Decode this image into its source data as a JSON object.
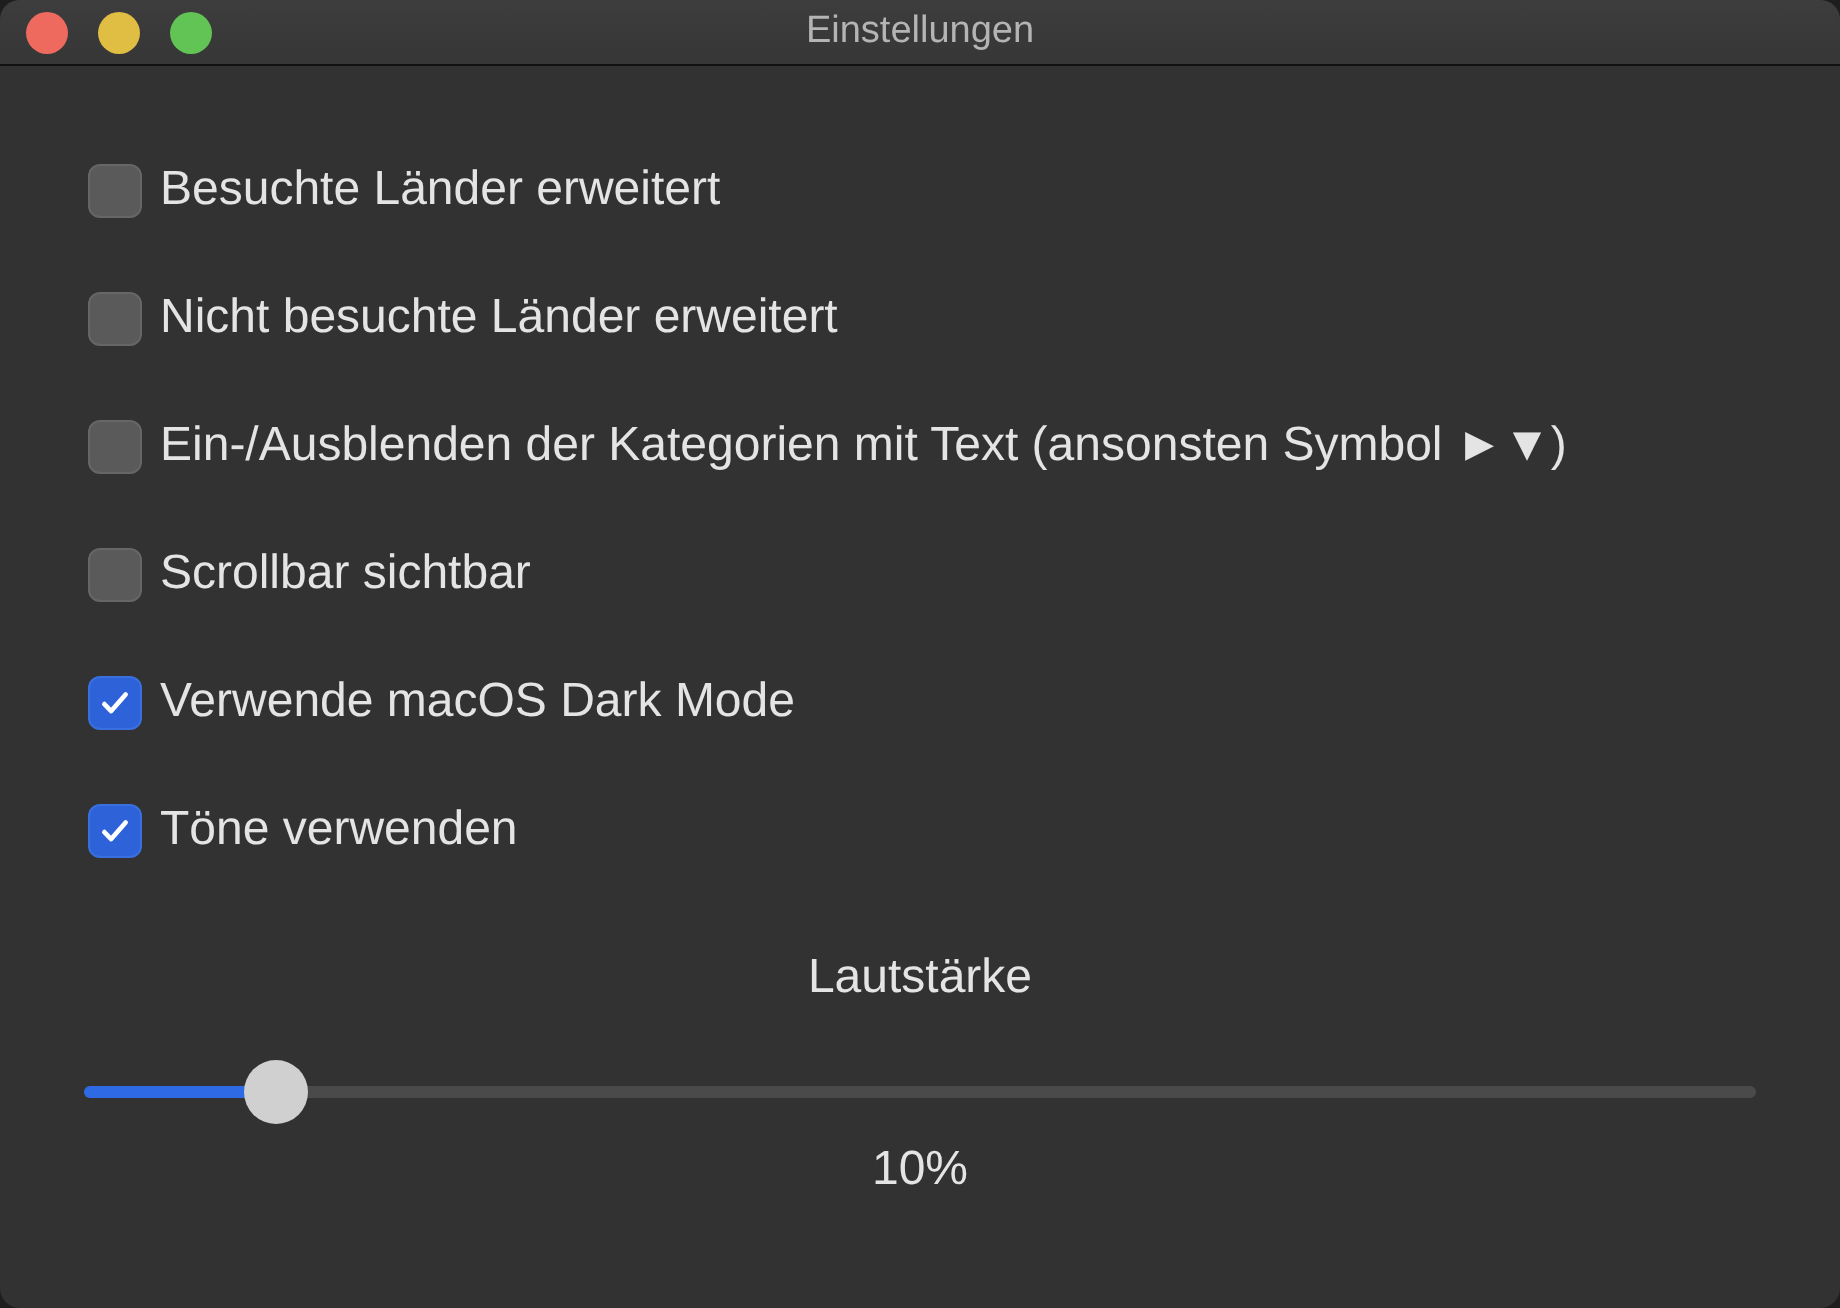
{
  "window": {
    "title": "Einstellungen"
  },
  "options": [
    {
      "label": "Besuchte Länder erweitert",
      "checked": false
    },
    {
      "label": "Nicht besuchte Länder erweitert",
      "checked": false
    },
    {
      "label": "Ein-/Ausblenden der Kategorien mit Text (ansonsten Symbol ►▼)",
      "checked": false
    },
    {
      "label": "Scrollbar sichtbar",
      "checked": false
    },
    {
      "label": "Verwende macOS Dark Mode",
      "checked": true
    },
    {
      "label": "Töne verwenden",
      "checked": true
    }
  ],
  "volume": {
    "label": "Lautstärke",
    "level": 0.1,
    "reading": "10%"
  }
}
